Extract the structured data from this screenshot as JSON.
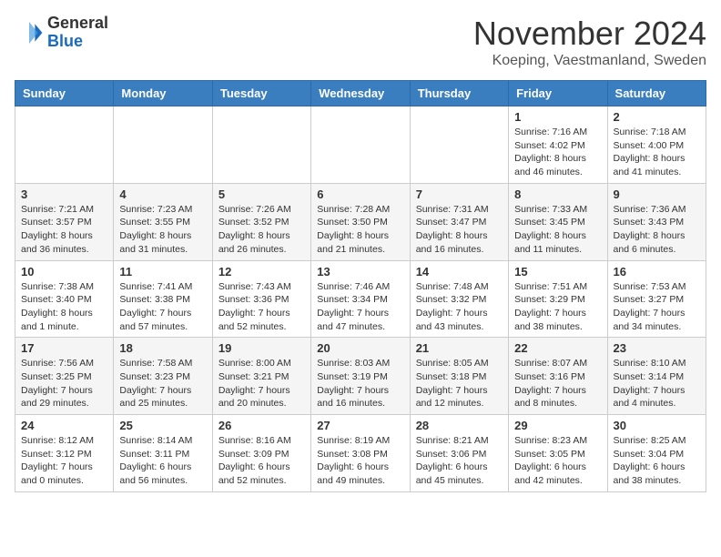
{
  "logo": {
    "general": "General",
    "blue": "Blue"
  },
  "header": {
    "month": "November 2024",
    "location": "Koeping, Vaestmanland, Sweden"
  },
  "weekdays": [
    "Sunday",
    "Monday",
    "Tuesday",
    "Wednesday",
    "Thursday",
    "Friday",
    "Saturday"
  ],
  "weeks": [
    [
      {
        "day": "",
        "info": ""
      },
      {
        "day": "",
        "info": ""
      },
      {
        "day": "",
        "info": ""
      },
      {
        "day": "",
        "info": ""
      },
      {
        "day": "",
        "info": ""
      },
      {
        "day": "1",
        "info": "Sunrise: 7:16 AM\nSunset: 4:02 PM\nDaylight: 8 hours and 46 minutes."
      },
      {
        "day": "2",
        "info": "Sunrise: 7:18 AM\nSunset: 4:00 PM\nDaylight: 8 hours and 41 minutes."
      }
    ],
    [
      {
        "day": "3",
        "info": "Sunrise: 7:21 AM\nSunset: 3:57 PM\nDaylight: 8 hours and 36 minutes."
      },
      {
        "day": "4",
        "info": "Sunrise: 7:23 AM\nSunset: 3:55 PM\nDaylight: 8 hours and 31 minutes."
      },
      {
        "day": "5",
        "info": "Sunrise: 7:26 AM\nSunset: 3:52 PM\nDaylight: 8 hours and 26 minutes."
      },
      {
        "day": "6",
        "info": "Sunrise: 7:28 AM\nSunset: 3:50 PM\nDaylight: 8 hours and 21 minutes."
      },
      {
        "day": "7",
        "info": "Sunrise: 7:31 AM\nSunset: 3:47 PM\nDaylight: 8 hours and 16 minutes."
      },
      {
        "day": "8",
        "info": "Sunrise: 7:33 AM\nSunset: 3:45 PM\nDaylight: 8 hours and 11 minutes."
      },
      {
        "day": "9",
        "info": "Sunrise: 7:36 AM\nSunset: 3:43 PM\nDaylight: 8 hours and 6 minutes."
      }
    ],
    [
      {
        "day": "10",
        "info": "Sunrise: 7:38 AM\nSunset: 3:40 PM\nDaylight: 8 hours and 1 minute."
      },
      {
        "day": "11",
        "info": "Sunrise: 7:41 AM\nSunset: 3:38 PM\nDaylight: 7 hours and 57 minutes."
      },
      {
        "day": "12",
        "info": "Sunrise: 7:43 AM\nSunset: 3:36 PM\nDaylight: 7 hours and 52 minutes."
      },
      {
        "day": "13",
        "info": "Sunrise: 7:46 AM\nSunset: 3:34 PM\nDaylight: 7 hours and 47 minutes."
      },
      {
        "day": "14",
        "info": "Sunrise: 7:48 AM\nSunset: 3:32 PM\nDaylight: 7 hours and 43 minutes."
      },
      {
        "day": "15",
        "info": "Sunrise: 7:51 AM\nSunset: 3:29 PM\nDaylight: 7 hours and 38 minutes."
      },
      {
        "day": "16",
        "info": "Sunrise: 7:53 AM\nSunset: 3:27 PM\nDaylight: 7 hours and 34 minutes."
      }
    ],
    [
      {
        "day": "17",
        "info": "Sunrise: 7:56 AM\nSunset: 3:25 PM\nDaylight: 7 hours and 29 minutes."
      },
      {
        "day": "18",
        "info": "Sunrise: 7:58 AM\nSunset: 3:23 PM\nDaylight: 7 hours and 25 minutes."
      },
      {
        "day": "19",
        "info": "Sunrise: 8:00 AM\nSunset: 3:21 PM\nDaylight: 7 hours and 20 minutes."
      },
      {
        "day": "20",
        "info": "Sunrise: 8:03 AM\nSunset: 3:19 PM\nDaylight: 7 hours and 16 minutes."
      },
      {
        "day": "21",
        "info": "Sunrise: 8:05 AM\nSunset: 3:18 PM\nDaylight: 7 hours and 12 minutes."
      },
      {
        "day": "22",
        "info": "Sunrise: 8:07 AM\nSunset: 3:16 PM\nDaylight: 7 hours and 8 minutes."
      },
      {
        "day": "23",
        "info": "Sunrise: 8:10 AM\nSunset: 3:14 PM\nDaylight: 7 hours and 4 minutes."
      }
    ],
    [
      {
        "day": "24",
        "info": "Sunrise: 8:12 AM\nSunset: 3:12 PM\nDaylight: 7 hours and 0 minutes."
      },
      {
        "day": "25",
        "info": "Sunrise: 8:14 AM\nSunset: 3:11 PM\nDaylight: 6 hours and 56 minutes."
      },
      {
        "day": "26",
        "info": "Sunrise: 8:16 AM\nSunset: 3:09 PM\nDaylight: 6 hours and 52 minutes."
      },
      {
        "day": "27",
        "info": "Sunrise: 8:19 AM\nSunset: 3:08 PM\nDaylight: 6 hours and 49 minutes."
      },
      {
        "day": "28",
        "info": "Sunrise: 8:21 AM\nSunset: 3:06 PM\nDaylight: 6 hours and 45 minutes."
      },
      {
        "day": "29",
        "info": "Sunrise: 8:23 AM\nSunset: 3:05 PM\nDaylight: 6 hours and 42 minutes."
      },
      {
        "day": "30",
        "info": "Sunrise: 8:25 AM\nSunset: 3:04 PM\nDaylight: 6 hours and 38 minutes."
      }
    ]
  ]
}
